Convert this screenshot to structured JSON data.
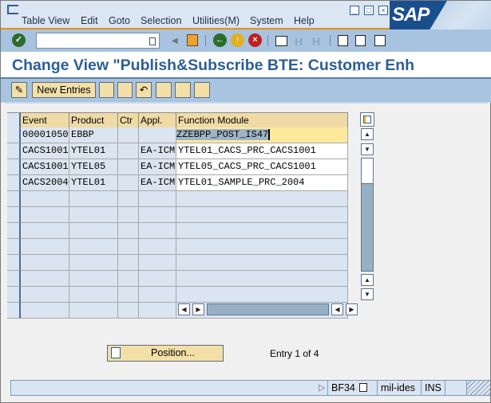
{
  "menu": [
    "Table View",
    "Edit",
    "Goto",
    "Selection",
    "Utilities(M)",
    "System",
    "Help"
  ],
  "logo": "SAP",
  "toolbar": {
    "command_value": "",
    "icons": [
      "enter-icon",
      "save-icon",
      "back-icon",
      "exit-icon",
      "cancel-icon",
      "print-icon",
      "find-icon",
      "find-next-icon",
      "first-page-icon",
      "previous-page-icon",
      "layout-icon"
    ]
  },
  "title": "Change View \"Publish&Subscribe BTE: Customer Enh",
  "title_more": "...",
  "app_toolbar": {
    "new_entries": "New Entries"
  },
  "table": {
    "columns": [
      "Event",
      "Product",
      "Ctr",
      "Appl.",
      "Function Module"
    ],
    "rows": [
      [
        "00001050",
        "EBBP",
        "",
        "",
        "ZZEBPP_POST_IS47"
      ],
      [
        "CACS1001",
        "YTEL01",
        "",
        "EA-ICM",
        "YTEL01_CACS_PRC_CACS1001"
      ],
      [
        "CACS1001",
        "YTEL05",
        "",
        "EA-ICM",
        "YTEL05_CACS_PRC_CACS1001"
      ],
      [
        "CACS2004",
        "YTEL01",
        "",
        "EA-ICM",
        "YTEL01_SAMPLE_PRC_2004"
      ]
    ],
    "empty_rows": 8
  },
  "position_button": "Position...",
  "entry_info": "Entry 1 of 4",
  "status": {
    "transaction": "BF34",
    "server": "mil-ides",
    "mode": "INS"
  },
  "colors": {
    "accent": "#2b5f96",
    "header": "#f0daa6",
    "selected": "#fde99b",
    "toolbar": "#a7c3df"
  }
}
